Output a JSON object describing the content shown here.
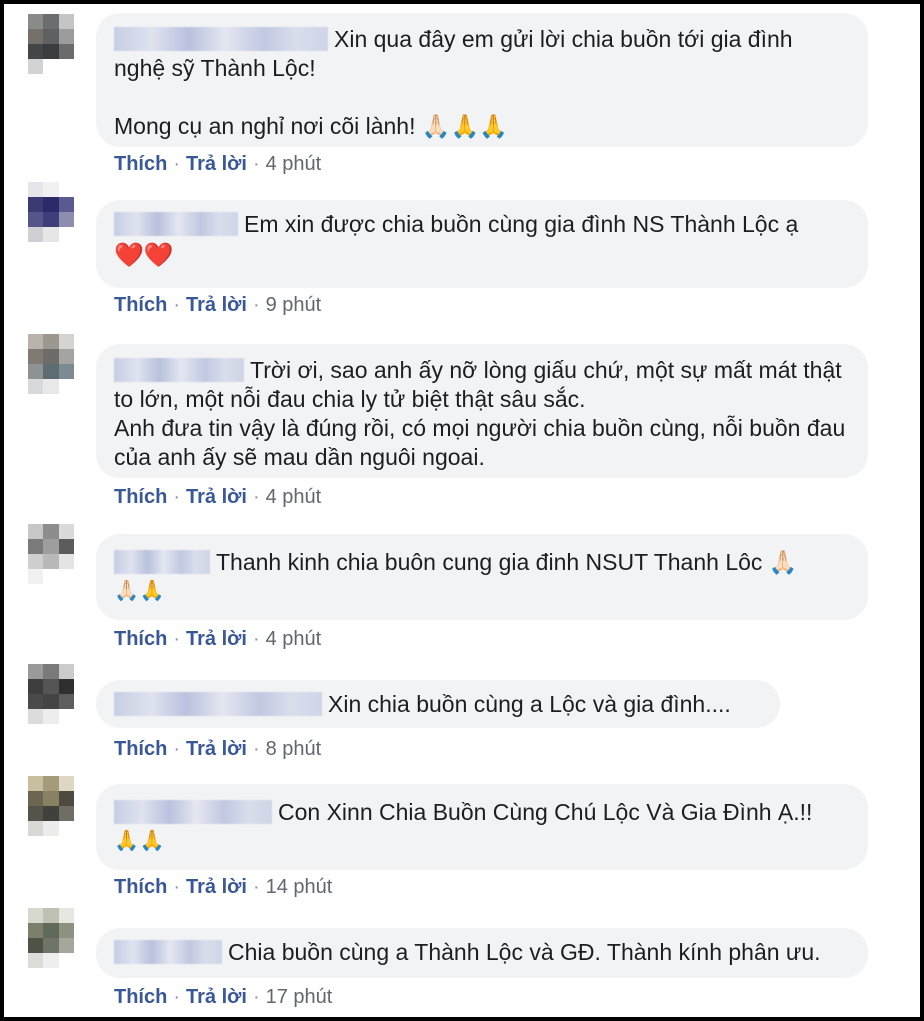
{
  "actions": {
    "like": "Thích",
    "reply": "Trả lời",
    "sep": "·"
  },
  "comments": [
    {
      "name_blur": "blurred-name",
      "text": "Xin qua đây em gửi lời chia buồn tới gia đình nghệ sỹ Thành Lộc!",
      "text2": "Mong cụ an nghỉ nơi cõi lành! 🙏🏻🙏🙏",
      "time": "4 phút"
    },
    {
      "text": "Em xin được chia buồn cùng gia đình NS Thành Lộc ạ",
      "emoji": "❤️❤️",
      "time": "9 phút"
    },
    {
      "text": "Trời ơi, sao anh ấy nỡ lòng giấu chứ, một sự mất mát thật to lớn, một nỗi đau chia ly tử biệt thật sâu sắc.",
      "text2": "Anh đưa tin vậy là đúng rồi, có mọi người chia buồn cùng, nỗi buồn đau của anh ấy sẽ mau dần nguôi ngoai.",
      "time": "4 phút"
    },
    {
      "text": "Thanh kinh chia buôn cung gia đinh NSUT Thanh Lôc 🙏🏻",
      "emoji": "🙏🏻🙏",
      "time": "4 phút"
    },
    {
      "text": "Xin chia buồn cùng a Lộc và gia đình....",
      "time": "8 phút"
    },
    {
      "text": "Con Xinn Chia Buồn Cùng Chú Lộc Và Gia Đình Ạ.!!",
      "emoji": "🙏🙏",
      "time": "14 phút"
    },
    {
      "text": "Chia buồn cùng a Thành Lộc và GĐ. Thành kính phân ưu.",
      "time": "17 phút"
    }
  ]
}
